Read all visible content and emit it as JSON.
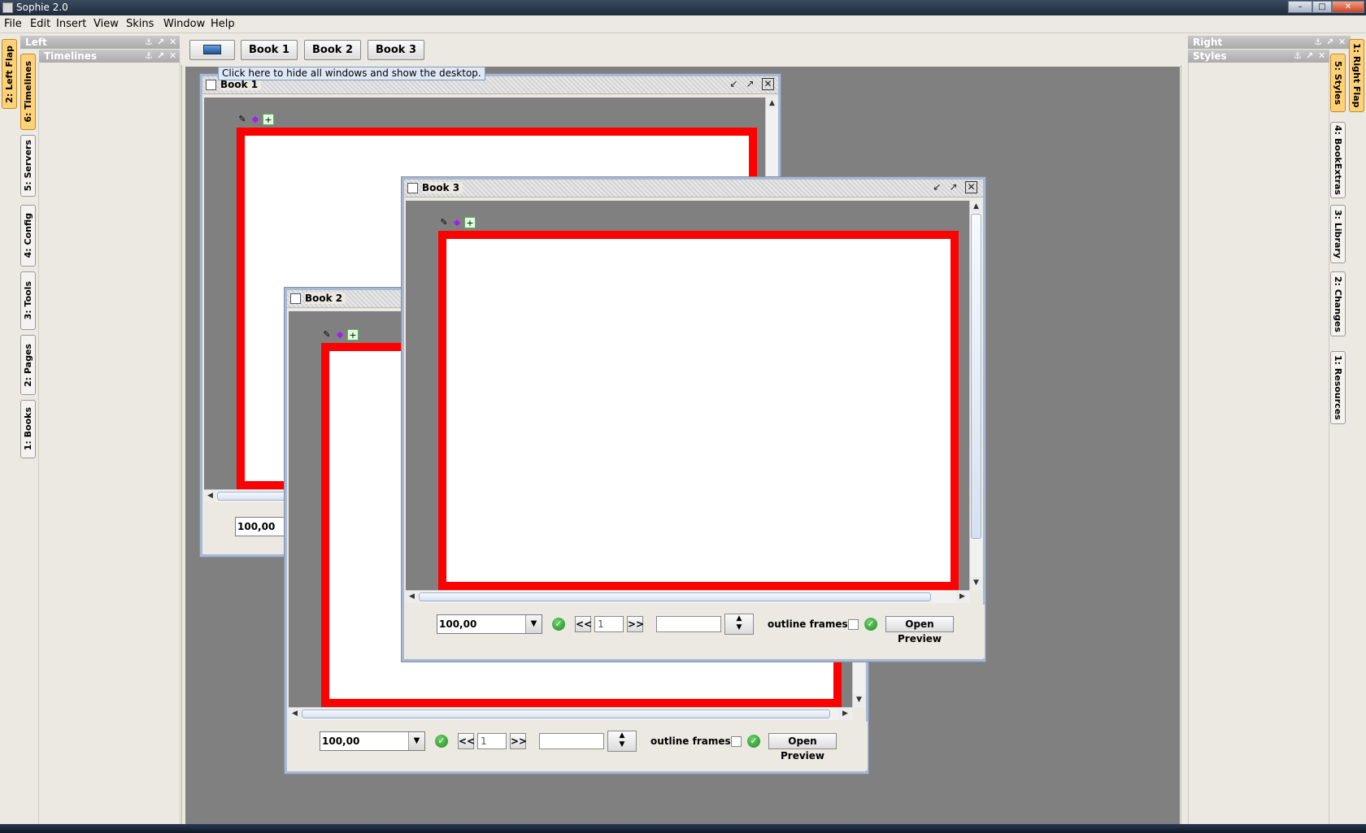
{
  "window": {
    "title": "Sophie 2.0"
  },
  "menu": [
    "File",
    "Edit",
    "Insert",
    "View",
    "Skins",
    "Window",
    "Help"
  ],
  "left_flap_tab": "2: Left Flap",
  "left_tabs": [
    "6: Timelines",
    "5: Servers",
    "4: Config",
    "3: Tools",
    "2: Pages",
    "1: Books"
  ],
  "left_panel": {
    "title": "Left",
    "sub_title": "Timelines"
  },
  "right_panel": {
    "title": "Right",
    "sub_title": "Styles"
  },
  "right_flap_tab": "1: Right Flap",
  "right_tabs": [
    "5: Styles",
    "4: BookExtras",
    "3: Library",
    "2: Changes",
    "1: Resources"
  ],
  "desktop_toolbar": {
    "books": [
      "Book 1",
      "Book 2",
      "Book 3"
    ]
  },
  "tooltip": "Click here to hide all windows and show the desktop.",
  "book1": {
    "title": "Book 1",
    "zoom": "100,00"
  },
  "book2": {
    "title": "Book 2",
    "zoom": "100,00",
    "page": "1",
    "prev": "<<",
    "next": ">>",
    "outline_label": "outline frames",
    "preview": "Open Preview"
  },
  "book3": {
    "title": "Book 3",
    "zoom": "100,00",
    "page": "1",
    "prev": "<<",
    "next": ">>",
    "outline_label": "outline frames",
    "preview": "Open Preview"
  },
  "colors": {
    "page_border": "#ff0000",
    "desktop_bg": "#808080"
  }
}
